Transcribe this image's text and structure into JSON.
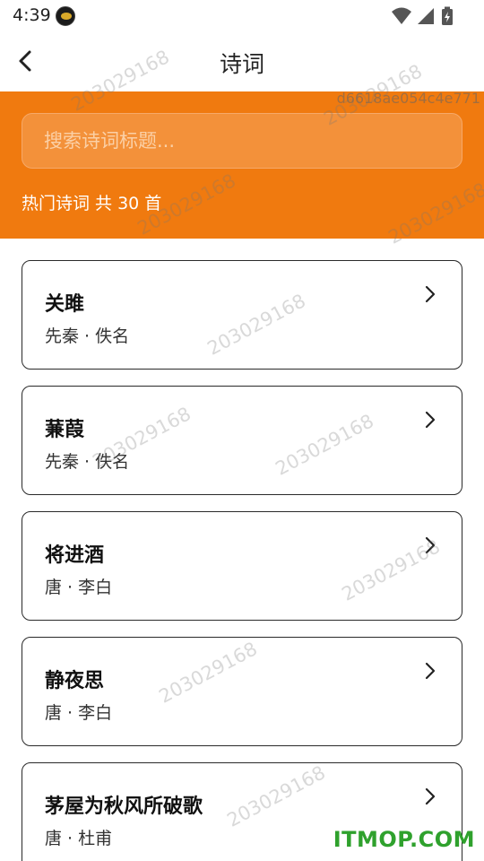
{
  "status_bar": {
    "time": "4:39",
    "icons": [
      "wifi-icon",
      "signal-icon",
      "battery-charging-icon"
    ]
  },
  "title_bar": {
    "title": "诗词",
    "back_icon": "chevron-left-icon"
  },
  "header": {
    "search_placeholder": "搜索诗词标题...",
    "hot_label": "热门诗词 共 30 首",
    "accent_color": "#f07a0f"
  },
  "poems": [
    {
      "title": "关雎",
      "meta": "先秦 · 佚名"
    },
    {
      "title": "蒹葭",
      "meta": "先秦 · 佚名"
    },
    {
      "title": "将进酒",
      "meta": "唐 · 李白"
    },
    {
      "title": "静夜思",
      "meta": "唐 · 李白"
    },
    {
      "title": "茅屋为秋风所破歌",
      "meta": "唐 · 杜甫"
    }
  ],
  "watermarks": {
    "number": "203029168",
    "hash": "d6618ae054c4e771",
    "site": "ITMOP.COM"
  }
}
